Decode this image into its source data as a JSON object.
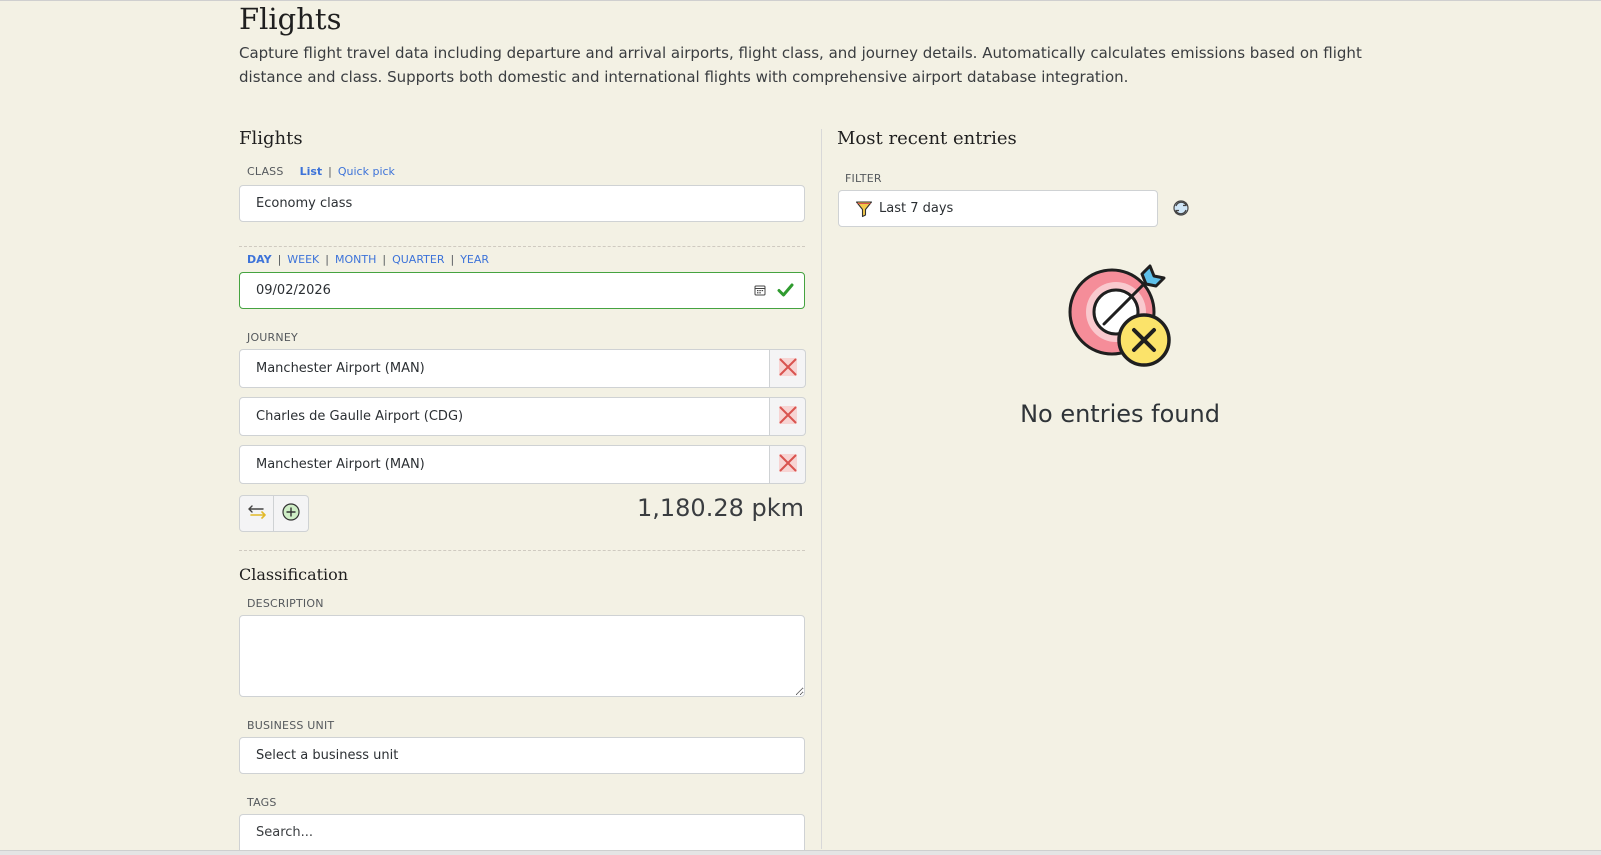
{
  "header": {
    "title": "Flights",
    "description": "Capture flight travel data including departure and arrival airports, flight class, and journey details. Automatically calculates emissions based on flight distance and class. Supports both domestic and international flights with comprehensive airport database integration."
  },
  "form": {
    "title": "Flights",
    "class_label": "CLASS",
    "class_modes": {
      "list": "List",
      "quick_pick": "Quick pick"
    },
    "class_value": "Economy class",
    "period_modes": [
      "DAY",
      "WEEK",
      "MONTH",
      "QUARTER",
      "YEAR"
    ],
    "date_value": "09/02/2026",
    "journey_label": "JOURNEY",
    "journey": [
      "Manchester Airport (MAN)",
      "Charles de Gaulle Airport (CDG)",
      "Manchester Airport (MAN)"
    ],
    "distance": "1,180.28 pkm",
    "classification_title": "Classification",
    "description_label": "DESCRIPTION",
    "description_value": "",
    "business_unit_label": "BUSINESS UNIT",
    "business_unit_value": "Select a business unit",
    "tags_label": "TAGS",
    "tags_placeholder": "Search..."
  },
  "recent": {
    "title": "Most recent entries",
    "filter_label": "FILTER",
    "filter_value": "Last 7 days",
    "empty_text": "No entries found"
  },
  "colors": {
    "background": "#f3f1e4",
    "link": "#3d73d9",
    "valid": "#45a340",
    "remove": "#d9534f"
  },
  "icons": {
    "calendar": "calendar-icon",
    "check": "check-icon",
    "remove": "close-icon",
    "swap": "swap-icon",
    "add": "plus-circle-icon",
    "filter": "funnel-icon",
    "refresh": "refresh-icon",
    "empty": "target-missed-icon"
  }
}
